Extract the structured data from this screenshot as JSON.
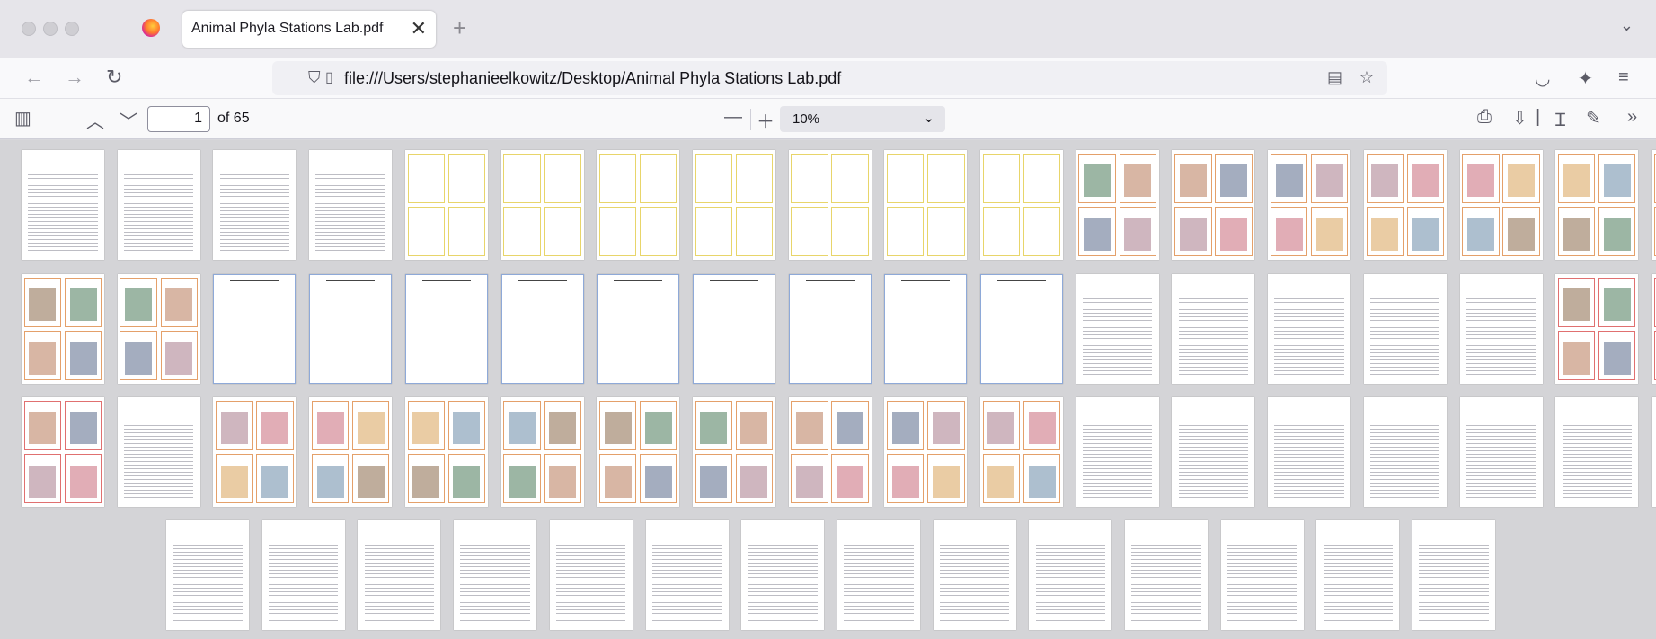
{
  "browser": {
    "tab_title": "Animal Phyla Stations Lab.pdf",
    "tab_close": "✕",
    "new_tab": "+",
    "tab_list": "⌄",
    "url": "file:///Users/stephanieelkowitz/Desktop/Animal Phyla Stations Lab.pdf"
  },
  "pdf": {
    "page_number": "1",
    "page_count_label": "of 65",
    "zoom": "10%",
    "total_pages": 65
  },
  "colors": {
    "yellow_border": "#e8d56a",
    "orange_border": "#e4a06a",
    "blue_border": "#8ea9d8",
    "red_border": "#e07070"
  }
}
